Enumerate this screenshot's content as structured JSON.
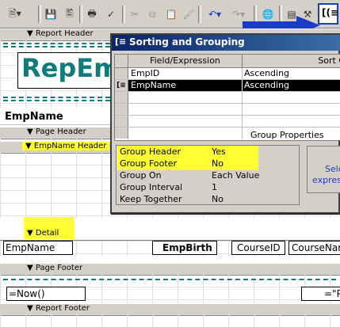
{
  "toolbar": {
    "buttons": [
      "view-icon",
      "save-icon",
      "print-preview-icon",
      "print-icon",
      "spelling-icon",
      "cut-icon",
      "copy-icon",
      "paste-icon",
      "format-painter-icon",
      "undo-icon",
      "redo-icon",
      "hyperlink-icon",
      "properties-icon",
      "build-icon",
      "sorting-grouping-icon"
    ]
  },
  "sections": {
    "report_header": "Report Header",
    "page_header": "Page Header",
    "empname_header": "EmpName Header",
    "detail": "Detail",
    "page_footer": "Page Footer",
    "report_footer": "Report Footer"
  },
  "report": {
    "title_label": "RepEm",
    "empname_group_label": "EmpName",
    "detail_fields": [
      "EmpName",
      "EmpBirth",
      "CourseID",
      "CourseNar"
    ],
    "page_footer_now": "=Now()",
    "page_footer_right": "=\"P"
  },
  "dialog": {
    "title": "Sorting and Grouping",
    "col_field": "Field/Expression",
    "col_sort": "Sort O",
    "rows": [
      {
        "field": "EmpID",
        "sort": "Ascending"
      },
      {
        "field": "EmpName",
        "sort": "Ascending"
      }
    ],
    "group_properties_label": "Group Properties",
    "properties": [
      {
        "label": "Group Header",
        "value": "Yes"
      },
      {
        "label": "Group Footer",
        "value": "No"
      },
      {
        "label": "Group On",
        "value": "Each Value"
      },
      {
        "label": "Group Interval",
        "value": "1"
      },
      {
        "label": "Keep Together",
        "value": "No"
      }
    ],
    "hint_line1": "Sele",
    "hint_line2": "expres"
  },
  "colors": {
    "highlight": "#ffff33",
    "title_teal": "#0e7c7b",
    "arrow_blue": "#1a3cc8"
  }
}
